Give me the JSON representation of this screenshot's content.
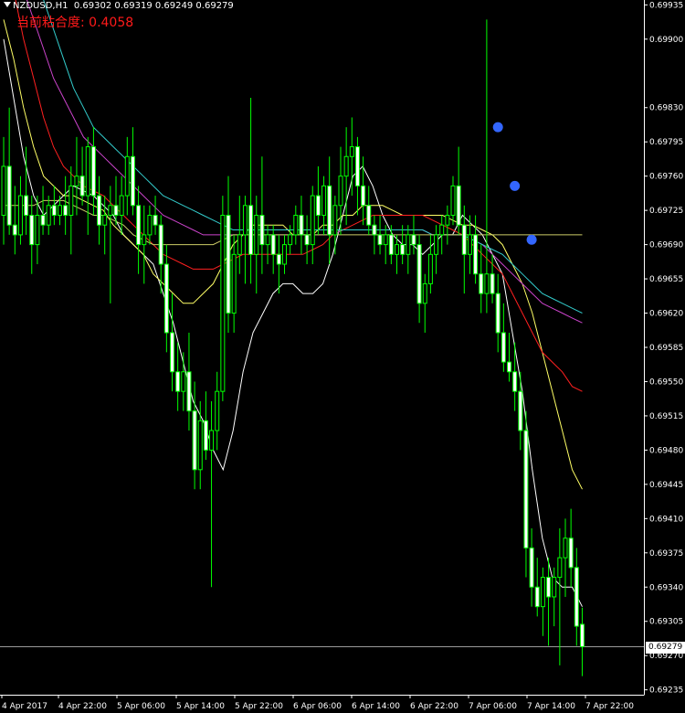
{
  "header": {
    "symbol": "NZDUSD,H1",
    "ohlc": "0.69302 0.69319 0.69249 0.69279"
  },
  "indicator": {
    "label": "当前粘合度:",
    "value": "0.4058",
    "color": "#ff1a1a"
  },
  "colors": {
    "background": "#000000",
    "axis": "#ffffff",
    "bull_candle": "#00ff00",
    "bear_candle": "#00ff00",
    "ma_white": "#ffffff",
    "ma_yellow": "#ffff66",
    "ma_red": "#ff2020",
    "ma_purple": "#cc44cc",
    "ma_cyan": "#33cccc",
    "ma_olive": "#cccc66",
    "dots": "#3366ff",
    "current_price_line": "#9a9a9a"
  },
  "chart_data": {
    "type": "candlestick",
    "current_price": "0.69279",
    "y_ticks": [
      "0.69935",
      "0.69900",
      "0.69830",
      "0.69795",
      "0.69760",
      "0.69725",
      "0.69690",
      "0.69655",
      "0.69620",
      "0.69585",
      "0.69550",
      "0.69515",
      "0.69480",
      "0.69445",
      "0.69410",
      "0.69375",
      "0.69340",
      "0.69305",
      "0.69270",
      "0.69235"
    ],
    "x_ticks": [
      "4 Apr 2017",
      "4 Apr 22:00",
      "5 Apr 06:00",
      "5 Apr 14:00",
      "5 Apr 22:00",
      "6 Apr 06:00",
      "6 Apr 14:00",
      "6 Apr 22:00",
      "7 Apr 06:00",
      "7 Apr 14:00",
      "7 Apr 22:00"
    ],
    "candles": [
      {
        "o": 0.6972,
        "h": 0.698,
        "l": 0.6969,
        "c": 0.6977
      },
      {
        "o": 0.6977,
        "h": 0.6983,
        "l": 0.697,
        "c": 0.6971
      },
      {
        "o": 0.6971,
        "h": 0.6975,
        "l": 0.6968,
        "c": 0.697
      },
      {
        "o": 0.697,
        "h": 0.6976,
        "l": 0.6969,
        "c": 0.6974
      },
      {
        "o": 0.6974,
        "h": 0.6979,
        "l": 0.697,
        "c": 0.6972
      },
      {
        "o": 0.6972,
        "h": 0.6974,
        "l": 0.6966,
        "c": 0.6969
      },
      {
        "o": 0.6969,
        "h": 0.6974,
        "l": 0.6967,
        "c": 0.6972
      },
      {
        "o": 0.6972,
        "h": 0.6975,
        "l": 0.697,
        "c": 0.6971
      },
      {
        "o": 0.6971,
        "h": 0.6974,
        "l": 0.697,
        "c": 0.6973
      },
      {
        "o": 0.6973,
        "h": 0.6975,
        "l": 0.6971,
        "c": 0.6972
      },
      {
        "o": 0.6972,
        "h": 0.6974,
        "l": 0.6971,
        "c": 0.6973
      },
      {
        "o": 0.6973,
        "h": 0.6976,
        "l": 0.697,
        "c": 0.6972
      },
      {
        "o": 0.6972,
        "h": 0.6977,
        "l": 0.6968,
        "c": 0.6975
      },
      {
        "o": 0.6975,
        "h": 0.698,
        "l": 0.6972,
        "c": 0.6976
      },
      {
        "o": 0.6976,
        "h": 0.6979,
        "l": 0.6973,
        "c": 0.6974
      },
      {
        "o": 0.6974,
        "h": 0.698,
        "l": 0.697,
        "c": 0.6979
      },
      {
        "o": 0.6979,
        "h": 0.6981,
        "l": 0.6972,
        "c": 0.6974
      },
      {
        "o": 0.6974,
        "h": 0.6976,
        "l": 0.6969,
        "c": 0.6971
      },
      {
        "o": 0.6971,
        "h": 0.6974,
        "l": 0.6968,
        "c": 0.6972
      },
      {
        "o": 0.6972,
        "h": 0.6975,
        "l": 0.6963,
        "c": 0.6973
      },
      {
        "o": 0.6973,
        "h": 0.6976,
        "l": 0.6971,
        "c": 0.6972
      },
      {
        "o": 0.6972,
        "h": 0.6976,
        "l": 0.697,
        "c": 0.6974
      },
      {
        "o": 0.6974,
        "h": 0.698,
        "l": 0.6972,
        "c": 0.6978
      },
      {
        "o": 0.6978,
        "h": 0.6981,
        "l": 0.6972,
        "c": 0.6973
      },
      {
        "o": 0.6973,
        "h": 0.6975,
        "l": 0.6966,
        "c": 0.6969
      },
      {
        "o": 0.6969,
        "h": 0.6973,
        "l": 0.6965,
        "c": 0.697
      },
      {
        "o": 0.697,
        "h": 0.6973,
        "l": 0.6969,
        "c": 0.6972
      },
      {
        "o": 0.6972,
        "h": 0.6974,
        "l": 0.697,
        "c": 0.6971
      },
      {
        "o": 0.6971,
        "h": 0.6972,
        "l": 0.6964,
        "c": 0.6967
      },
      {
        "o": 0.6967,
        "h": 0.6969,
        "l": 0.6958,
        "c": 0.696
      },
      {
        "o": 0.696,
        "h": 0.6964,
        "l": 0.6954,
        "c": 0.6956
      },
      {
        "o": 0.6956,
        "h": 0.6959,
        "l": 0.6952,
        "c": 0.6954
      },
      {
        "o": 0.6954,
        "h": 0.6958,
        "l": 0.6952,
        "c": 0.6956
      },
      {
        "o": 0.6956,
        "h": 0.696,
        "l": 0.695,
        "c": 0.6952
      },
      {
        "o": 0.6952,
        "h": 0.6955,
        "l": 0.6944,
        "c": 0.6946
      },
      {
        "o": 0.6946,
        "h": 0.6953,
        "l": 0.6944,
        "c": 0.6951
      },
      {
        "o": 0.6951,
        "h": 0.6954,
        "l": 0.6947,
        "c": 0.6948
      },
      {
        "o": 0.6948,
        "h": 0.6953,
        "l": 0.6934,
        "c": 0.695
      },
      {
        "o": 0.695,
        "h": 0.6956,
        "l": 0.6948,
        "c": 0.6954
      },
      {
        "o": 0.6954,
        "h": 0.6974,
        "l": 0.6953,
        "c": 0.6972
      },
      {
        "o": 0.6972,
        "h": 0.6976,
        "l": 0.696,
        "c": 0.6962
      },
      {
        "o": 0.6962,
        "h": 0.697,
        "l": 0.696,
        "c": 0.6968
      },
      {
        "o": 0.6968,
        "h": 0.6974,
        "l": 0.6966,
        "c": 0.697
      },
      {
        "o": 0.697,
        "h": 0.6974,
        "l": 0.6965,
        "c": 0.6973
      },
      {
        "o": 0.6973,
        "h": 0.6984,
        "l": 0.6965,
        "c": 0.6968
      },
      {
        "o": 0.6968,
        "h": 0.6974,
        "l": 0.6964,
        "c": 0.6972
      },
      {
        "o": 0.6972,
        "h": 0.6978,
        "l": 0.6966,
        "c": 0.6969
      },
      {
        "o": 0.6969,
        "h": 0.6971,
        "l": 0.6967,
        "c": 0.697
      },
      {
        "o": 0.697,
        "h": 0.6971,
        "l": 0.6966,
        "c": 0.6968
      },
      {
        "o": 0.6968,
        "h": 0.697,
        "l": 0.6964,
        "c": 0.6967
      },
      {
        "o": 0.6967,
        "h": 0.697,
        "l": 0.6966,
        "c": 0.6969
      },
      {
        "o": 0.6969,
        "h": 0.6971,
        "l": 0.6968,
        "c": 0.697
      },
      {
        "o": 0.697,
        "h": 0.6973,
        "l": 0.6969,
        "c": 0.6972
      },
      {
        "o": 0.6972,
        "h": 0.6974,
        "l": 0.6968,
        "c": 0.697
      },
      {
        "o": 0.697,
        "h": 0.6972,
        "l": 0.6967,
        "c": 0.6969
      },
      {
        "o": 0.6969,
        "h": 0.6975,
        "l": 0.6967,
        "c": 0.6974
      },
      {
        "o": 0.6974,
        "h": 0.6977,
        "l": 0.697,
        "c": 0.6972
      },
      {
        "o": 0.6972,
        "h": 0.6976,
        "l": 0.697,
        "c": 0.6975
      },
      {
        "o": 0.6975,
        "h": 0.6978,
        "l": 0.6967,
        "c": 0.697
      },
      {
        "o": 0.697,
        "h": 0.6974,
        "l": 0.6968,
        "c": 0.6973
      },
      {
        "o": 0.6973,
        "h": 0.6979,
        "l": 0.697,
        "c": 0.6976
      },
      {
        "o": 0.6976,
        "h": 0.6981,
        "l": 0.6971,
        "c": 0.6978
      },
      {
        "o": 0.6978,
        "h": 0.6982,
        "l": 0.6974,
        "c": 0.6979
      },
      {
        "o": 0.6979,
        "h": 0.698,
        "l": 0.6972,
        "c": 0.6975
      },
      {
        "o": 0.6975,
        "h": 0.6978,
        "l": 0.6971,
        "c": 0.6973
      },
      {
        "o": 0.6973,
        "h": 0.6975,
        "l": 0.697,
        "c": 0.6971
      },
      {
        "o": 0.6971,
        "h": 0.6972,
        "l": 0.6968,
        "c": 0.697
      },
      {
        "o": 0.697,
        "h": 0.6972,
        "l": 0.6968,
        "c": 0.6969
      },
      {
        "o": 0.6969,
        "h": 0.6971,
        "l": 0.6967,
        "c": 0.697
      },
      {
        "o": 0.697,
        "h": 0.6971,
        "l": 0.6967,
        "c": 0.6968
      },
      {
        "o": 0.6968,
        "h": 0.697,
        "l": 0.6966,
        "c": 0.6969
      },
      {
        "o": 0.6969,
        "h": 0.6971,
        "l": 0.6967,
        "c": 0.6968
      },
      {
        "o": 0.6968,
        "h": 0.6971,
        "l": 0.6966,
        "c": 0.697
      },
      {
        "o": 0.697,
        "h": 0.6972,
        "l": 0.6968,
        "c": 0.6969
      },
      {
        "o": 0.6969,
        "h": 0.697,
        "l": 0.6961,
        "c": 0.6963
      },
      {
        "o": 0.6963,
        "h": 0.6966,
        "l": 0.696,
        "c": 0.6965
      },
      {
        "o": 0.6965,
        "h": 0.697,
        "l": 0.6964,
        "c": 0.6968
      },
      {
        "o": 0.6968,
        "h": 0.6971,
        "l": 0.6966,
        "c": 0.697
      },
      {
        "o": 0.697,
        "h": 0.6972,
        "l": 0.6968,
        "c": 0.6971
      },
      {
        "o": 0.6971,
        "h": 0.6973,
        "l": 0.6969,
        "c": 0.6972
      },
      {
        "o": 0.6972,
        "h": 0.6976,
        "l": 0.6971,
        "c": 0.6975
      },
      {
        "o": 0.6975,
        "h": 0.6979,
        "l": 0.697,
        "c": 0.6971
      },
      {
        "o": 0.6971,
        "h": 0.6973,
        "l": 0.6964,
        "c": 0.6968
      },
      {
        "o": 0.6968,
        "h": 0.6972,
        "l": 0.6966,
        "c": 0.697
      },
      {
        "o": 0.697,
        "h": 0.6972,
        "l": 0.6965,
        "c": 0.6966
      },
      {
        "o": 0.6966,
        "h": 0.6969,
        "l": 0.6962,
        "c": 0.6964
      },
      {
        "o": 0.6964,
        "h": 0.6992,
        "l": 0.6962,
        "c": 0.6966
      },
      {
        "o": 0.6966,
        "h": 0.6968,
        "l": 0.6963,
        "c": 0.6964
      },
      {
        "o": 0.6964,
        "h": 0.6966,
        "l": 0.6958,
        "c": 0.696
      },
      {
        "o": 0.696,
        "h": 0.6963,
        "l": 0.6956,
        "c": 0.6957
      },
      {
        "o": 0.6957,
        "h": 0.696,
        "l": 0.6955,
        "c": 0.6956
      },
      {
        "o": 0.6956,
        "h": 0.6959,
        "l": 0.6952,
        "c": 0.6954
      },
      {
        "o": 0.6954,
        "h": 0.6956,
        "l": 0.6948,
        "c": 0.695
      },
      {
        "o": 0.695,
        "h": 0.6952,
        "l": 0.6935,
        "c": 0.6938
      },
      {
        "o": 0.6938,
        "h": 0.694,
        "l": 0.6932,
        "c": 0.6934
      },
      {
        "o": 0.6934,
        "h": 0.6937,
        "l": 0.6931,
        "c": 0.6932
      },
      {
        "o": 0.6932,
        "h": 0.6936,
        "l": 0.6929,
        "c": 0.6935
      },
      {
        "o": 0.6935,
        "h": 0.6937,
        "l": 0.6928,
        "c": 0.6933
      },
      {
        "o": 0.6933,
        "h": 0.6936,
        "l": 0.693,
        "c": 0.6935
      },
      {
        "o": 0.6935,
        "h": 0.694,
        "l": 0.6926,
        "c": 0.6937
      },
      {
        "o": 0.6937,
        "h": 0.6941,
        "l": 0.6933,
        "c": 0.6939
      },
      {
        "o": 0.6939,
        "h": 0.6942,
        "l": 0.6934,
        "c": 0.6936
      },
      {
        "o": 0.6936,
        "h": 0.6938,
        "l": 0.6928,
        "c": 0.693
      },
      {
        "o": 0.69302,
        "h": 0.69319,
        "l": 0.69249,
        "c": 0.69279
      }
    ],
    "moving_averages": [
      {
        "color_key": "ma_white",
        "points": [
          0.699,
          0.6984,
          0.6978,
          0.6974,
          0.6972,
          0.6973,
          0.6974,
          0.6975,
          0.69745,
          0.6974,
          0.6973,
          0.6972,
          0.697,
          0.6969,
          0.6968,
          0.6967,
          0.6964,
          0.6961,
          0.6957,
          0.6953,
          0.6951,
          0.6948,
          0.6946,
          0.695,
          0.6956,
          0.696,
          0.6962,
          0.6964,
          0.6965,
          0.6965,
          0.6964,
          0.6964,
          0.6965,
          0.6968,
          0.6972,
          0.6976,
          0.6977,
          0.6975,
          0.6972,
          0.697,
          0.6969,
          0.6969,
          0.6968,
          0.6969,
          0.697,
          0.697,
          0.6972,
          0.6971,
          0.697,
          0.6968,
          0.6966,
          0.696,
          0.6954,
          0.6946,
          0.6939,
          0.6935,
          0.6934,
          0.6934,
          0.6932
        ]
      },
      {
        "color_key": "ma_yellow",
        "points": [
          0.6992,
          0.6988,
          0.6983,
          0.6979,
          0.6976,
          0.6975,
          0.6974,
          0.6974,
          0.69735,
          0.6973,
          0.69725,
          0.6971,
          0.697,
          0.6969,
          0.6968,
          0.6966,
          0.6965,
          0.6964,
          0.6963,
          0.6963,
          0.6964,
          0.6965,
          0.6967,
          0.6969,
          0.697,
          0.6971,
          0.6971,
          0.6971,
          0.6971,
          0.697,
          0.697,
          0.697,
          0.6971,
          0.6971,
          0.6972,
          0.6972,
          0.6973,
          0.6973,
          0.6973,
          0.69725,
          0.6972,
          0.6972,
          0.6972,
          0.6972,
          0.6972,
          0.69715,
          0.6971,
          0.6971,
          0.69705,
          0.697,
          0.6969,
          0.6967,
          0.6965,
          0.6962,
          0.6958,
          0.6954,
          0.695,
          0.6946,
          0.6944
        ]
      },
      {
        "color_key": "ma_red",
        "points": [
          0.6999,
          0.6995,
          0.699,
          0.6986,
          0.6982,
          0.6979,
          0.6977,
          0.6976,
          0.6975,
          0.69745,
          0.6974,
          0.6973,
          0.6972,
          0.6971,
          0.697,
          0.6969,
          0.6968,
          0.69675,
          0.6967,
          0.69665,
          0.69665,
          0.69665,
          0.6967,
          0.69675,
          0.6968,
          0.6968,
          0.6968,
          0.6968,
          0.6968,
          0.6968,
          0.6968,
          0.69685,
          0.6969,
          0.697,
          0.69705,
          0.6971,
          0.69715,
          0.6972,
          0.6972,
          0.6972,
          0.6972,
          0.6972,
          0.6972,
          0.69715,
          0.6971,
          0.69705,
          0.697,
          0.6969,
          0.6968,
          0.6967,
          0.6966,
          0.6964,
          0.6962,
          0.696,
          0.6958,
          0.6957,
          0.6956,
          0.69545,
          0.6954
        ]
      },
      {
        "color_key": "ma_purple",
        "points": [
          0.7,
          0.6998,
          0.6995,
          0.6992,
          0.6989,
          0.6986,
          0.6984,
          0.6982,
          0.698,
          0.6979,
          0.6978,
          0.6977,
          0.6976,
          0.6975,
          0.6974,
          0.6973,
          0.6972,
          0.69715,
          0.6971,
          0.69705,
          0.697,
          0.697,
          0.697,
          0.697,
          0.697,
          0.697,
          0.697,
          0.697,
          0.697,
          0.697,
          0.697,
          0.697,
          0.697,
          0.697,
          0.69705,
          0.69705,
          0.69705,
          0.69705,
          0.69705,
          0.69705,
          0.69705,
          0.69705,
          0.69705,
          0.697,
          0.697,
          0.697,
          0.697,
          0.69695,
          0.6969,
          0.6968,
          0.6967,
          0.6966,
          0.6965,
          0.6964,
          0.6963,
          0.69625,
          0.6962,
          0.69615,
          0.6961
        ]
      },
      {
        "color_key": "ma_cyan",
        "points": [
          0.7,
          0.7,
          0.6999,
          0.6997,
          0.6994,
          0.6991,
          0.6988,
          0.6985,
          0.6983,
          0.6981,
          0.698,
          0.6979,
          0.6978,
          0.6977,
          0.6976,
          0.6975,
          0.6974,
          0.69735,
          0.6973,
          0.69725,
          0.6972,
          0.69715,
          0.6971,
          0.69705,
          0.69705,
          0.69705,
          0.69705,
          0.69705,
          0.69705,
          0.69705,
          0.69705,
          0.69705,
          0.69705,
          0.69705,
          0.69705,
          0.69705,
          0.69705,
          0.69705,
          0.69705,
          0.69705,
          0.69705,
          0.69705,
          0.69705,
          0.697,
          0.697,
          0.697,
          0.697,
          0.69695,
          0.6969,
          0.69685,
          0.6968,
          0.6967,
          0.6966,
          0.6965,
          0.6964,
          0.69635,
          0.6963,
          0.69625,
          0.6962
        ]
      },
      {
        "color_key": "ma_olive",
        "points": [
          0.6973,
          0.6973,
          0.6973,
          0.6973,
          0.69735,
          0.69735,
          0.69735,
          0.6973,
          0.69725,
          0.6972,
          0.6972,
          0.69715,
          0.6971,
          0.697,
          0.69695,
          0.6969,
          0.6969,
          0.6969,
          0.6969,
          0.6969,
          0.6969,
          0.6969,
          0.69695,
          0.697,
          0.697,
          0.697,
          0.697,
          0.697,
          0.697,
          0.697,
          0.697,
          0.697,
          0.697,
          0.697,
          0.697,
          0.697,
          0.697,
          0.697,
          0.697,
          0.697,
          0.697,
          0.697,
          0.697,
          0.697,
          0.697,
          0.697,
          0.697,
          0.697,
          0.697,
          0.697,
          0.697,
          0.697,
          0.697,
          0.697,
          0.697,
          0.697,
          0.697,
          0.697,
          0.697
        ]
      }
    ],
    "dots": [
      {
        "candle": 88,
        "price": 0.6981
      },
      {
        "candle": 91,
        "price": 0.6975
      },
      {
        "candle": 94,
        "price": 0.69695
      }
    ]
  }
}
